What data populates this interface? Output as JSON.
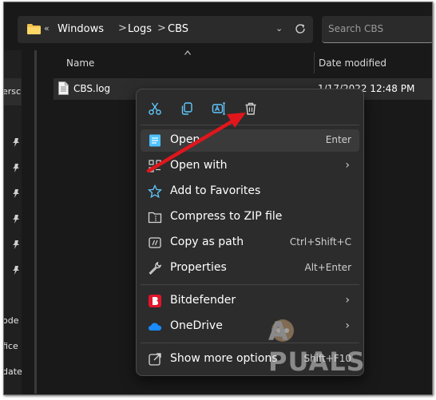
{
  "breadcrumb": {
    "chevrons": "«",
    "items": [
      "Windows",
      "Logs",
      "CBS"
    ],
    "separator": ">"
  },
  "search": {
    "placeholder": "Search CBS"
  },
  "sidebar": {
    "items": [
      "ersc",
      "ode",
      "fice",
      "date"
    ]
  },
  "columns": {
    "name": "Name",
    "date_modified": "Date modified"
  },
  "file": {
    "name": "CBS.log",
    "date": "1/17/2022 12:48 PM"
  },
  "quick_actions": [
    "cut-icon",
    "copy-icon",
    "rename-icon",
    "delete-icon"
  ],
  "menu": {
    "items": [
      {
        "label": "Open",
        "shortcut": "Enter"
      },
      {
        "label": "Open with",
        "shortcut": ""
      },
      {
        "label": "Add to Favorites",
        "shortcut": ""
      },
      {
        "label": "Compress to ZIP file",
        "shortcut": ""
      },
      {
        "label": "Copy as path",
        "shortcut": "Ctrl+Shift+C"
      },
      {
        "label": "Properties",
        "shortcut": "Alt+Enter"
      },
      {
        "label": "Bitdefender",
        "shortcut": ""
      },
      {
        "label": "OneDrive",
        "shortcut": ""
      },
      {
        "label": "Show more options",
        "shortcut": "Shift+F10"
      }
    ]
  },
  "watermark": "A  PUALS",
  "colors": {
    "accent": "#4cc2ff",
    "annotation_arrow": "#e0161c",
    "bitdefender": "#e2152b",
    "onedrive": "#1a8cff"
  }
}
